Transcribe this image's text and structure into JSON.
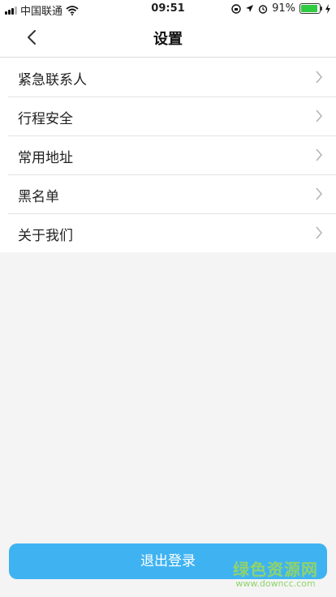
{
  "status_bar": {
    "carrier": "中国联通",
    "time": "09:51",
    "battery_percent": "91%",
    "battery_level": 0.91,
    "icons": [
      "signal-icon",
      "wifi-icon",
      "orientation-lock-icon",
      "location-arrow-icon",
      "alarm-icon",
      "battery-icon",
      "charging-icon"
    ]
  },
  "navbar": {
    "title": "设置",
    "back_icon": "chevron-left-icon"
  },
  "settings": {
    "items": [
      {
        "label": "紧急联系人"
      },
      {
        "label": "行程安全"
      },
      {
        "label": "常用地址"
      },
      {
        "label": "黑名单"
      },
      {
        "label": "关于我们"
      }
    ]
  },
  "logout_button": {
    "label": "退出登录"
  },
  "watermark": {
    "name": "绿色资源网",
    "url": "www.downcc.com"
  },
  "colors": {
    "accent": "#3fb3f2",
    "background": "#f4f4f4",
    "watermark": "#8fd36b"
  }
}
